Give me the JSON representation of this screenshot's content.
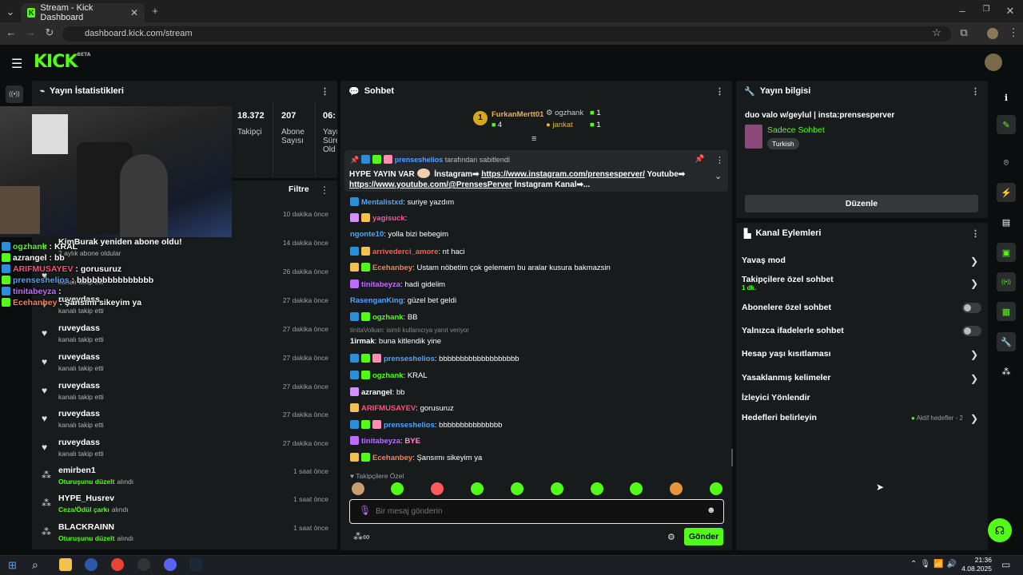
{
  "browser": {
    "tab_title": "Stream - Kick Dashboard",
    "url": "dashboard.kick.com/stream"
  },
  "header": {
    "logo": "KICK",
    "beta": "BETA"
  },
  "stats": {
    "title": "Yayın İstatistikleri",
    "followers": "18.372",
    "followers_label": "Takipçi",
    "subs": "207",
    "subs_label": "Abone Sayısı",
    "third": "06:",
    "third_label": "Yayı Süre Old"
  },
  "activity": {
    "filter_label": "Filtre",
    "rows": [
      {
        "name": "KimBurak yeniden abone oldu!",
        "sub": "2 aylık abone oldular",
        "time": ""
      },
      {
        "name": "",
        "sub": "",
        "time": "10 dakika önce"
      },
      {
        "name": "",
        "sub": "",
        "time": "14 dakika önce"
      },
      {
        "name": "",
        "sub": "kanalı takip etti",
        "time": "26 dakika önce"
      },
      {
        "name": "ruveydass",
        "sub": "kanalı takip etti",
        "time": "27 dakika önce"
      },
      {
        "name": "ruveydass",
        "sub": "kanalı takip etti",
        "time": "27 dakika önce"
      },
      {
        "name": "ruveydass",
        "sub": "kanalı takip etti",
        "time": "27 dakika önce"
      },
      {
        "name": "ruveydass",
        "sub": "kanalı takip etti",
        "time": "27 dakika önce"
      },
      {
        "name": "ruveydass",
        "sub": "kanalı takip etti",
        "time": "27 dakika önce"
      },
      {
        "name": "ruveydass",
        "sub": "kanalı takip etti",
        "time": "27 dakika önce"
      },
      {
        "name": "emirben1",
        "sub": "Oturuşunu düzelt",
        "sub2": "alındı",
        "time": "1 saat önce"
      },
      {
        "name": "HYPE_Husrev",
        "sub": "Ceza/Ödül çarkı",
        "sub2": "alındı",
        "time": "1 saat önce"
      },
      {
        "name": "BLACKRAINN",
        "sub": "Oturuşunu düzelt",
        "sub2": "alındı",
        "time": "1 saat önce"
      }
    ]
  },
  "overlay_chat": [
    {
      "user": "ogzhank",
      "text": "KRAL",
      "color": "#53fc18"
    },
    {
      "user": "azrangel",
      "text": "bb",
      "color": "#fff"
    },
    {
      "user": "ARIFMUSAYEV",
      "text": "gorusuruz",
      "color": "#ff4f7a"
    },
    {
      "user": "prenseshelios",
      "text": "bbbbbbbbbbbbbbb",
      "color": "#4fa3ff"
    },
    {
      "user": "tinitabeyza",
      "text": "",
      "color": "#c06bff"
    },
    {
      "user": "Ecehanbey",
      "text": "Şansımı sikeyim ya",
      "color": "#ff7b5a"
    }
  ],
  "chat": {
    "title": "Sohbet",
    "top": [
      {
        "user": "FurkanMertt01",
        "count": "4",
        "rank": "1"
      },
      {
        "user": "ogzhank",
        "count": "1"
      },
      {
        "user": "jankat",
        "count": "1"
      }
    ],
    "pinned_by": "prenseshelios",
    "pinned_suffix": "tarafından sabitlendi",
    "pinned_text1": "HYPE YAYIN VAR",
    "pinned_text2": "İnstagram➡",
    "pinned_link1": "https://www.instagram.com/prensesperver/",
    "pinned_text3": "Youtube➡",
    "pinned_link2": "https://www.youtube.com/@PrensesPerver",
    "pinned_text4": "İnstagram Kanal➡...",
    "messages": [
      {
        "user": "Mentalistxd",
        "text": "suriye yazdım",
        "color": "#4fa3ff"
      },
      {
        "user": "yagisuck",
        "text": "",
        "color": "#ff4fa3"
      },
      {
        "user": "ngonte10",
        "text": "yolla bizi bebegim",
        "color": "#4fa3ff"
      },
      {
        "user": "arrivederci_amore",
        "text": "nt haci",
        "color": "#ff5a5a"
      },
      {
        "user": "Ecehanbey",
        "text": "Ustam nöbetim çok gelemem bu aralar kusura bakmazsin",
        "color": "#ff7b5a"
      },
      {
        "user": "tinitabeyza",
        "text": "hadi gidelim",
        "color": "#c06bff"
      },
      {
        "user": "RasenganKing",
        "text": "güzel bet geldi",
        "color": "#4fa3ff"
      },
      {
        "user": "ogzhank",
        "text": "BB",
        "color": "#53fc18"
      },
      {
        "user": "1irmak",
        "text": "buna kitlendik yine",
        "color": "#fff",
        "reply": "tinitaVolkan: isimli kullanıcıya yanıt veriyor"
      },
      {
        "user": "prenseshelios",
        "text": "bbbbbbbbbbbbbbbbbbb",
        "color": "#4fa3ff"
      },
      {
        "user": "ogzhank",
        "text": "KRAL",
        "color": "#53fc18"
      },
      {
        "user": "azrangel",
        "text": "bb",
        "color": "#fff"
      },
      {
        "user": "ARIFMUSAYEV",
        "text": "gorusuruz",
        "color": "#ff4f7a"
      },
      {
        "user": "prenseshelios",
        "text": "bbbbbbbbbbbbbbb",
        "color": "#4fa3ff"
      },
      {
        "user": "tinitabeyza",
        "text": "BYE",
        "color": "#c06bff"
      },
      {
        "user": "Ecehanbey",
        "text": "Şansımı sikeyim ya",
        "color": "#ff7b5a"
      }
    ],
    "followers_only": "Takipçilere Özel",
    "placeholder": "Bir mesaj gönderin",
    "send": "Gönder"
  },
  "stream_info": {
    "title": "Yayın bilgisi",
    "stream_title": "duo valo w/geylul | insta:prensesperver",
    "category": "Sadece Sohbet",
    "tag": "Turkish",
    "edit": "Düzenle"
  },
  "channel_actions": {
    "title": "Kanal Eylemleri",
    "items": [
      {
        "label": "Yavaş mod"
      },
      {
        "label": "Takipçilere özel sohbet",
        "sub": "1 dk."
      },
      {
        "label": "Abonelere özel sohbet"
      },
      {
        "label": "Yalnızca ifadelerle sohbet"
      },
      {
        "label": "Hesap yaşı kısıtlaması"
      },
      {
        "label": "Yasaklanmış kelimeler"
      },
      {
        "label": "İzleyici Yönlendir"
      },
      {
        "label": "Hedefleri belirleyin",
        "sub": "Aktif hedefler - 2"
      }
    ]
  },
  "taskbar": {
    "time": "21:36",
    "date": "4.08.2025"
  }
}
